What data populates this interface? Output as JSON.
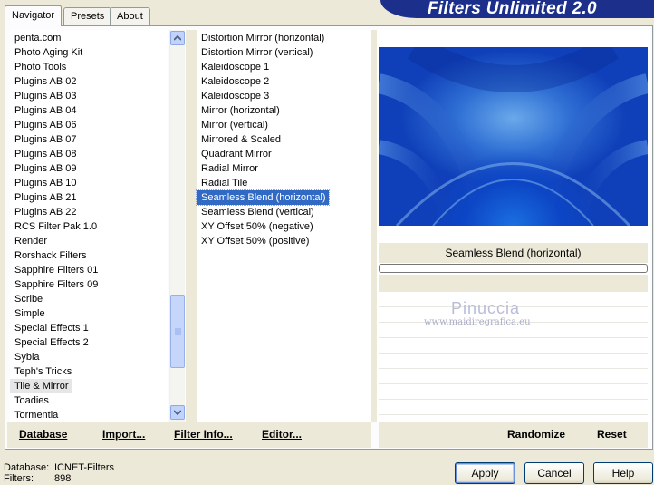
{
  "tabs": [
    {
      "label": "Navigator",
      "active": true
    },
    {
      "label": "Presets",
      "active": false
    },
    {
      "label": "About",
      "active": false
    }
  ],
  "app_title": "Filters Unlimited 2.0",
  "categories": {
    "items": [
      "penta.com",
      "Photo Aging Kit",
      "Photo Tools",
      "Plugins AB 02",
      "Plugins AB 03",
      "Plugins AB 04",
      "Plugins AB 06",
      "Plugins AB 07",
      "Plugins AB 08",
      "Plugins AB 09",
      "Plugins AB 10",
      "Plugins AB 21",
      "Plugins AB 22",
      "RCS Filter Pak 1.0",
      "Render",
      "Rorshack Filters",
      "Sapphire Filters 01",
      "Sapphire Filters 09",
      "Scribe",
      "Simple",
      "Special Effects 1",
      "Special Effects 2",
      "Sybia",
      "Teph's Tricks",
      "Tile & Mirror",
      "Toadies",
      "Tormentia"
    ],
    "selected": "Tile & Mirror"
  },
  "filters": {
    "items": [
      "Distortion Mirror (horizontal)",
      "Distortion Mirror (vertical)",
      "Kaleidoscope 1",
      "Kaleidoscope 2",
      "Kaleidoscope 3",
      "Mirror (horizontal)",
      "Mirror (vertical)",
      "Mirrored & Scaled",
      "Quadrant Mirror",
      "Radial Mirror",
      "Radial Tile",
      "Seamless Blend (horizontal)",
      "Seamless Blend (vertical)",
      "XY Offset 50% (negative)",
      "XY Offset 50% (positive)"
    ],
    "selected": "Seamless Blend (horizontal)"
  },
  "left_buttons": {
    "database": "Database",
    "import": "Import...",
    "filter_info": "Filter Info...",
    "editor": "Editor..."
  },
  "right_buttons": {
    "randomize": "Randomize",
    "reset": "Reset"
  },
  "preview": {
    "effect_name": "Seamless Blend (horizontal)",
    "progress": 0
  },
  "watermark": {
    "name": "Pinuccia",
    "url": "www.maidiregrafica.eu"
  },
  "status": {
    "database_label": "Database:",
    "database_value": "ICNET-Filters",
    "filters_label": "Filters:",
    "filters_value": "898"
  },
  "dialog_buttons": {
    "apply": "Apply",
    "cancel": "Cancel",
    "help": "Help"
  },
  "colors": {
    "selection": "#316ac5",
    "banner": "#1c2f8a",
    "window": "#ece9d8"
  }
}
